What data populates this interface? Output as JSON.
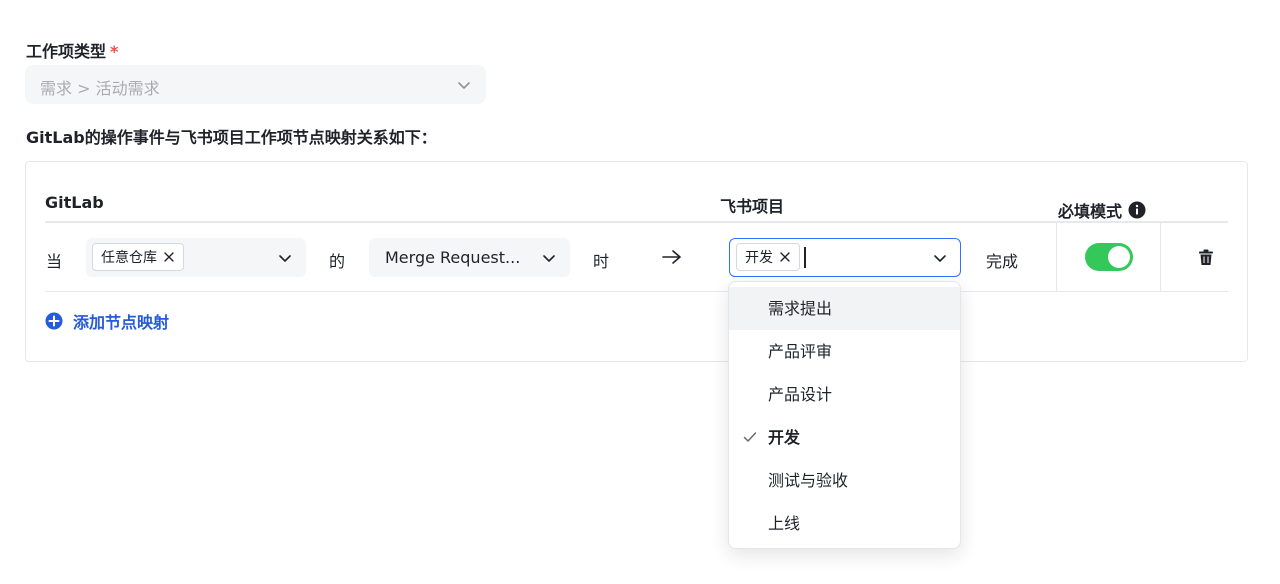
{
  "form": {
    "type_label": "工作项类型",
    "required_mark": "*",
    "type_value": "需求 > 活动需求",
    "mapping_description": "GitLab的操作事件与飞书项目工作项节点映射关系如下："
  },
  "table": {
    "headers": {
      "gitlab": "GitLab",
      "feishu": "飞书项目",
      "required_mode": "必填模式"
    },
    "row": {
      "when_text": "当",
      "repo_tag": "任意仓库",
      "of_text": "的",
      "event_value": "Merge Request...",
      "time_text": "时",
      "node_tag": "开发",
      "complete_text": "完成",
      "required_mode_on": true
    },
    "add_link": "添加节点映射"
  },
  "dropdown": {
    "options": [
      {
        "label": "需求提出",
        "selected": false
      },
      {
        "label": "产品评审",
        "selected": false
      },
      {
        "label": "产品设计",
        "selected": false
      },
      {
        "label": "开发",
        "selected": true
      },
      {
        "label": "测试与验收",
        "selected": false
      },
      {
        "label": "上线",
        "selected": false
      }
    ]
  },
  "colors": {
    "accent": "#3370ff",
    "link": "#245bdb",
    "toggle_on": "#34c759",
    "required": "#f54a45"
  }
}
